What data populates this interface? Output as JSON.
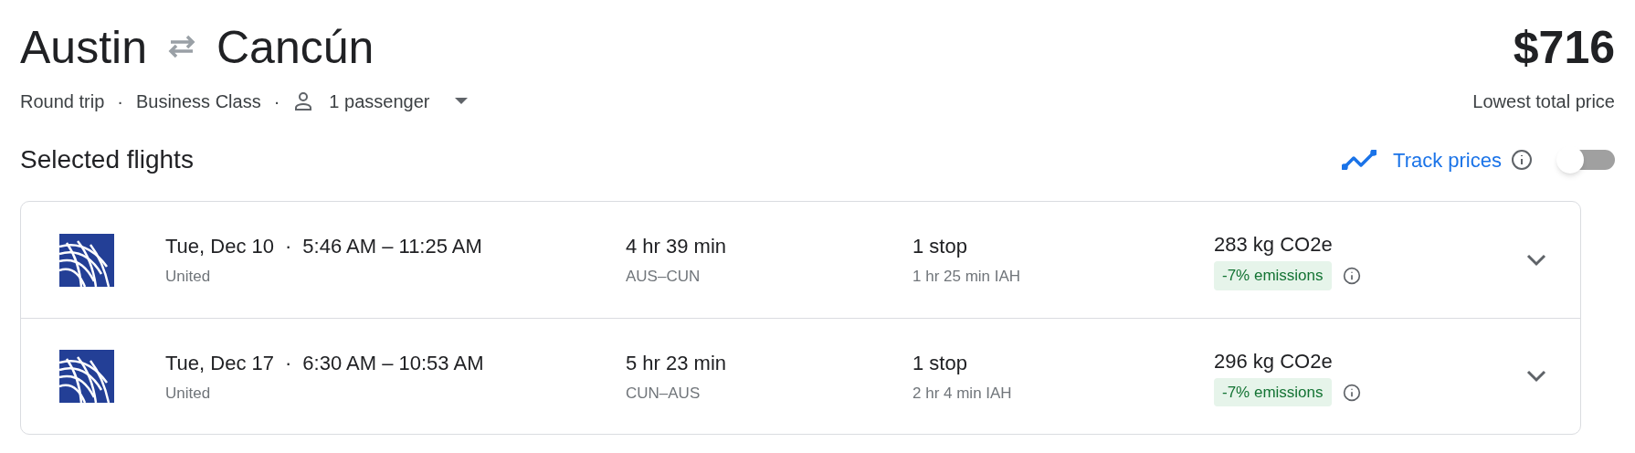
{
  "route": {
    "origin": "Austin",
    "destination": "Cancún"
  },
  "trip_details": {
    "trip_type": "Round trip",
    "separator_1": "·",
    "cabin": "Business Class",
    "separator_2": "·",
    "passengers": "1 passenger"
  },
  "price": {
    "amount": "$716",
    "label": "Lowest total price"
  },
  "section_title": "Selected flights",
  "track_prices": {
    "label": "Track prices",
    "on": false
  },
  "flights": [
    {
      "date": "Tue, Dec 10",
      "separator": "·",
      "times": "5:46 AM – 11:25 AM",
      "airline": "United",
      "duration": "4 hr 39 min",
      "route": "AUS–CUN",
      "stops": "1 stop",
      "layover": "1 hr 25 min IAH",
      "emissions": "283 kg CO2e",
      "emissions_badge": "-7% emissions"
    },
    {
      "date": "Tue, Dec 17",
      "separator": "·",
      "times": "6:30 AM – 10:53 AM",
      "airline": "United",
      "duration": "5 hr 23 min",
      "route": "CUN–AUS",
      "stops": "1 stop",
      "layover": "2 hr 4 min IAH",
      "emissions": "296 kg CO2e",
      "emissions_badge": "-7% emissions"
    }
  ]
}
